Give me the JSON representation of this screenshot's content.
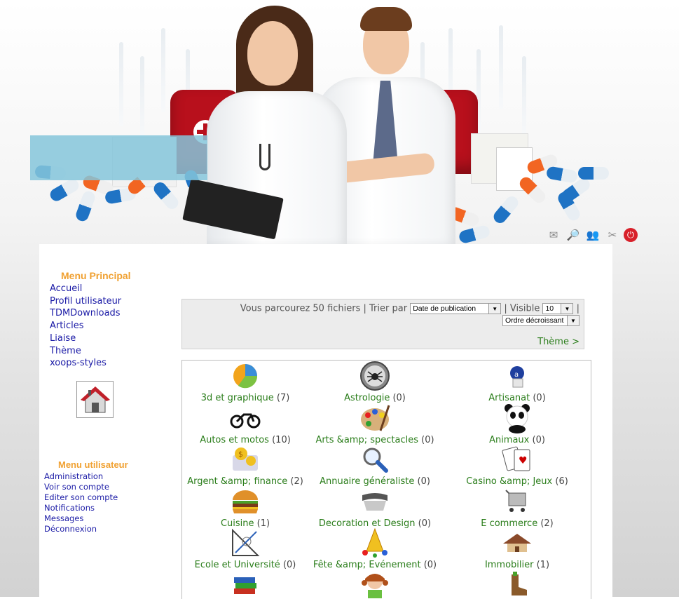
{
  "header": {
    "toolbar_icons": [
      {
        "name": "envelope-icon",
        "glyph": "✉"
      },
      {
        "name": "search-doc-icon",
        "glyph": "🔎"
      },
      {
        "name": "users-icon",
        "glyph": "👥"
      },
      {
        "name": "tools-icon",
        "glyph": "✂"
      },
      {
        "name": "power-icon",
        "glyph": "⏻"
      }
    ]
  },
  "sidebar": {
    "main_menu": {
      "title": "Menu Principal",
      "items": [
        "Accueil",
        "Profil utilisateur",
        "TDMDownloads",
        "Articles",
        "Liaise",
        "Thème",
        "xoops-styles"
      ]
    },
    "home_icon": "home-icon",
    "user_menu": {
      "title": "Menu utilisateur",
      "items": [
        "Administration",
        "Voir son compte",
        "Editer son compte",
        "Notifications",
        "Messages",
        "Déconnexion"
      ]
    }
  },
  "toolbar": {
    "browse_text": "Vous parcourez 50 fichiers | Trier par",
    "sort_select": "Date de publication",
    "visible_label": "| Visible",
    "visible_select": "10",
    "pipe": "|",
    "order_select": "Ordre décroissant",
    "theme_link": "Thème >"
  },
  "categories": [
    {
      "name": "3d et graphique",
      "count": "(7)",
      "icon": "pie-chart-icon"
    },
    {
      "name": "Astrologie",
      "count": "(0)",
      "icon": "spider-icon"
    },
    {
      "name": "Artisanat",
      "count": "(0)",
      "icon": "craft-icon"
    },
    {
      "name": "Autos et motos",
      "count": "(10)",
      "icon": "motorbike-icon"
    },
    {
      "name": "Arts &amp; spectacles",
      "count": "(0)",
      "icon": "palette-icon"
    },
    {
      "name": "Animaux",
      "count": "(0)",
      "icon": "panda-icon"
    },
    {
      "name": "Argent &amp; finance",
      "count": "(2)",
      "icon": "money-icon"
    },
    {
      "name": "Annuaire généraliste",
      "count": "(0)",
      "icon": "magnifier-icon"
    },
    {
      "name": "Casino &amp; Jeux",
      "count": "(6)",
      "icon": "playing-cards-icon"
    },
    {
      "name": "Cuisine",
      "count": "(1)",
      "icon": "burger-icon"
    },
    {
      "name": "Decoration et Design",
      "count": "(0)",
      "icon": "design-chair-icon"
    },
    {
      "name": "E commerce",
      "count": "(2)",
      "icon": "shopping-cart-icon"
    },
    {
      "name": "Ecole et Université",
      "count": "(0)",
      "icon": "drafting-tools-icon"
    },
    {
      "name": "Fête &amp; Evénement",
      "count": "(0)",
      "icon": "party-icon"
    },
    {
      "name": "Immobilier",
      "count": "(1)",
      "icon": "house-icon"
    },
    {
      "name": "",
      "count": "",
      "icon": "books-icon"
    },
    {
      "name": "",
      "count": "",
      "icon": "girl-icon"
    },
    {
      "name": "",
      "count": "",
      "icon": "boot-icon"
    }
  ]
}
